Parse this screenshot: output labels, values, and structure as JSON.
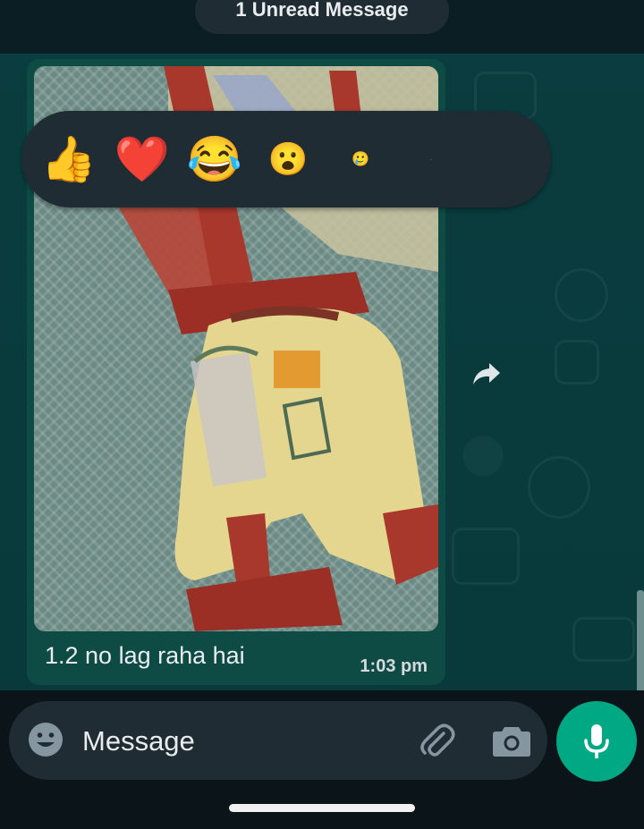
{
  "banner": {
    "unread_text": "1 Unread Message"
  },
  "message": {
    "caption": "1.2 no lag raha hai",
    "time": "1:03 pm",
    "image_alt": "Child's yellow shorts with red straps on a lace cloth"
  },
  "reactions": [
    {
      "emoji": "👍",
      "name": "thumbs-up"
    },
    {
      "emoji": "❤️",
      "name": "red-heart"
    },
    {
      "emoji": "😂",
      "name": "tears-of-joy"
    },
    {
      "emoji": "😮",
      "name": "open-mouth"
    },
    {
      "emoji": "🥲",
      "name": "smiling-tear"
    },
    {
      "emoji": "·",
      "name": "more"
    }
  ],
  "composer": {
    "placeholder": "Message"
  },
  "colors": {
    "accent": "#00a884",
    "bubble": "#0f4b45",
    "panel": "#1f2c33"
  },
  "icons": [
    "forward-icon",
    "emoji-icon",
    "attach-icon",
    "camera-icon",
    "mic-icon"
  ]
}
